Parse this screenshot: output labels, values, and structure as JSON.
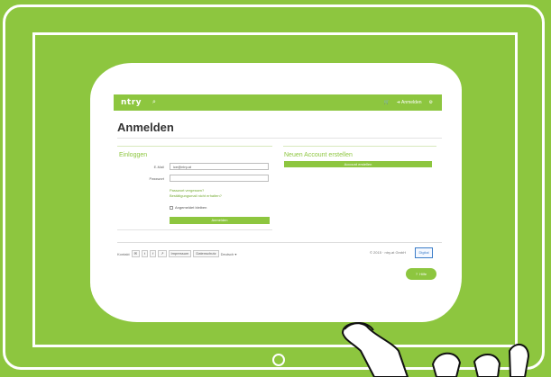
{
  "brand": {
    "logo": "ntry"
  },
  "header": {
    "search_icon": "search-icon",
    "cart_icon": "cart-icon",
    "login_label": "Anmelden",
    "settings_icon": "gear-icon"
  },
  "page": {
    "title": "Anmelden"
  },
  "login": {
    "heading": "Einloggen",
    "email_label": "E-Mail",
    "email_value": "ice@ntry.at",
    "password_label": "Passwort",
    "password_value": "",
    "link_forgot": "Passwort vergessen?",
    "link_confirm": "Bestätigungsmail nicht erhalten?",
    "remember_label": "Angemeldet bleiben",
    "submit_label": "Anmelden"
  },
  "register": {
    "heading": "Neuen Account erstellen",
    "button_label": "Account erstellen"
  },
  "footer": {
    "contact_label": "Kontakt",
    "icons": [
      "mail-icon",
      "twitter-icon",
      "facebook-icon",
      "link-icon"
    ],
    "imprint_label": "Impressum",
    "terms_label": "Datenschutz",
    "language_label": "Deutsch",
    "copyright": "© 2015 · ntry.at GmbH",
    "seal_text": "Digital"
  },
  "help": {
    "label": "Hilfe"
  },
  "colors": {
    "brand_green": "#8dc63f",
    "white": "#ffffff"
  }
}
